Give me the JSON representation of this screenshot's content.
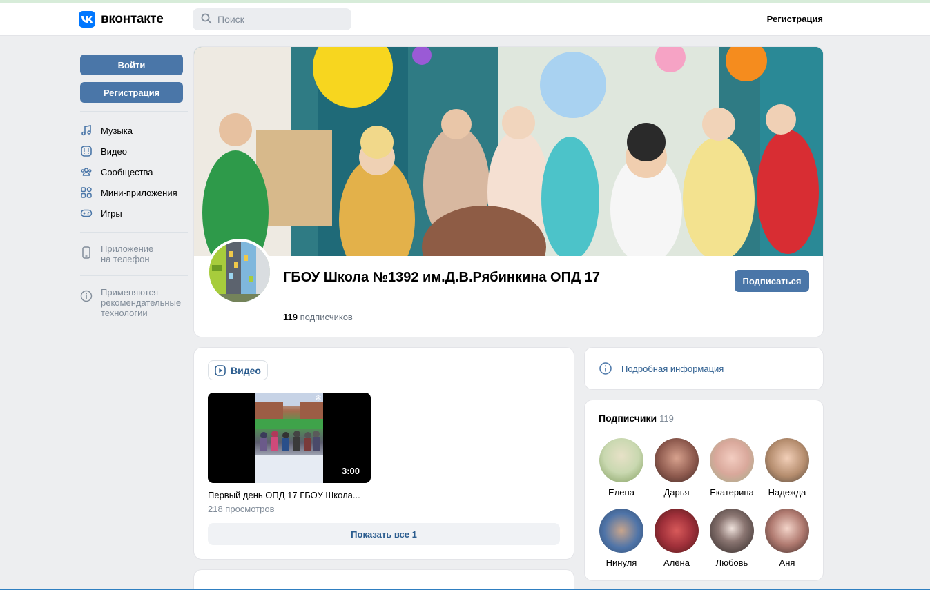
{
  "header": {
    "logo_text": "вконтакте",
    "search_placeholder": "Поиск",
    "register_link": "Регистрация"
  },
  "sidebar": {
    "login_button": "Войти",
    "register_button": "Регистрация",
    "nav": [
      {
        "label": "Музыка",
        "icon": "music-icon"
      },
      {
        "label": "Видео",
        "icon": "video-icon"
      },
      {
        "label": "Сообщества",
        "icon": "communities-icon"
      },
      {
        "label": "Мини-приложения",
        "icon": "mini-apps-icon"
      },
      {
        "label": "Игры",
        "icon": "gamepad-icon"
      }
    ],
    "app_note_line1": "Приложение",
    "app_note_line2": "на телефон",
    "rec_note_line1": "Применяются",
    "rec_note_line2": "рекомендательные",
    "rec_note_line3": "технологии"
  },
  "profile": {
    "title": "ГБОУ Школа №1392 им.Д.В.Рябинкина ОПД 17",
    "subscribers_count": "119",
    "subscribers_label": "подписчиков",
    "subscribe_button": "Подписаться"
  },
  "video_block": {
    "tab_label": "Видео",
    "video_title": "Первый день ОПД 17 ГБОУ Школа...",
    "video_duration": "3:00",
    "video_views": "218 просмотров",
    "show_all": "Показать все 1"
  },
  "info": {
    "label": "Подробная информация"
  },
  "subscribers": {
    "title": "Подписчики",
    "count": "119",
    "people": [
      {
        "name": "Елена",
        "color": "#c9d8b0"
      },
      {
        "name": "Дарья",
        "color": "#8e5a4e"
      },
      {
        "name": "Екатерина",
        "color": "#d9a89b"
      },
      {
        "name": "Надежда",
        "color": "#b58d6e"
      },
      {
        "name": "Нинуля",
        "color": "#4f74a8"
      },
      {
        "name": "Алёна",
        "color": "#a0303a"
      },
      {
        "name": "Любовь",
        "color": "#5a4a48"
      },
      {
        "name": "Аня",
        "color": "#b07a70"
      }
    ]
  },
  "colors": {
    "accent": "#4a76a8",
    "link": "#2c5d8f",
    "logo": "#0077ff"
  }
}
